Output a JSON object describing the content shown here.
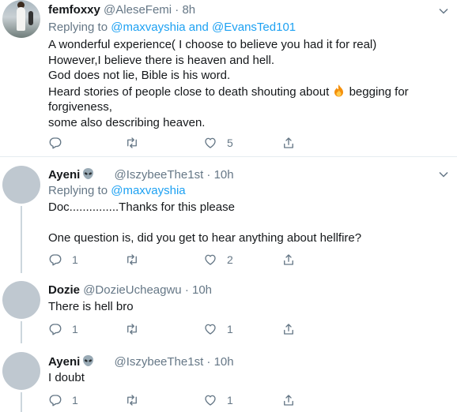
{
  "tweets": [
    {
      "name": "femfoxxy",
      "handle": "@AleseFemi",
      "time": "· 8h",
      "replying_prefix": "Replying to ",
      "replying_to": "@maxvayshia and @EvansTed101",
      "lines": [
        "A  wonderful experience( I choose to believe you had it for real)",
        "However,I believe  there is heaven and hell.",
        "God does not lie, Bible is his word.",
        "Heard stories of people close to death shouting about",
        "begging for",
        "forgiveness,",
        "some also describing heaven."
      ],
      "reply_count": "",
      "retweet_count": "",
      "like_count": "5"
    },
    {
      "name": "Ayeni",
      "handle": "@IszybeeThe1st",
      "time": "· 10h",
      "replying_prefix": "Replying to ",
      "replying_to": "@maxvayshia",
      "lines": [
        "Doc...............Thanks for this please",
        "One question is, did you get to hear anything about hellfire?"
      ],
      "reply_count": "1",
      "retweet_count": "",
      "like_count": "2"
    },
    {
      "name": "Dozie",
      "handle": "@DozieUcheagwu",
      "time": "· 10h",
      "lines": [
        "There is hell bro"
      ],
      "reply_count": "1",
      "retweet_count": "",
      "like_count": "1"
    },
    {
      "name": "Ayeni",
      "handle": "@IszybeeThe1st",
      "time": "· 10h",
      "lines": [
        "I doubt"
      ],
      "reply_count": "1",
      "retweet_count": "",
      "like_count": "1"
    }
  ],
  "icons": {
    "reply": "reply-icon",
    "retweet": "retweet-icon",
    "like": "heart-icon",
    "share": "share-icon",
    "more": "chevron-down-icon",
    "alien": "alien-emoji-icon",
    "fire": "fire-emoji-icon"
  },
  "colors": {
    "link": "#1da1f2",
    "muted": "#657786",
    "text": "#14171a",
    "divider": "#e6ecf0"
  }
}
